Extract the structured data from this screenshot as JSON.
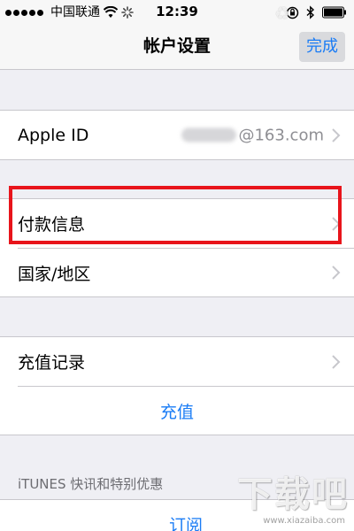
{
  "status_bar": {
    "carrier": "中国联通",
    "time": "12:39"
  },
  "nav": {
    "title": "帐户设置",
    "done_label": "完成"
  },
  "account_group": {
    "apple_id_label": "Apple ID",
    "apple_id_value_suffix": "@163.com"
  },
  "payment_group": {
    "payment_info_label": "付款信息",
    "country_region_label": "国家/地区"
  },
  "recharge_group": {
    "recharge_history_label": "充值记录",
    "recharge_label": "充值"
  },
  "itunes_section": {
    "header": "iTUNES 快讯和特别优惠",
    "subscribe_label": "订阅"
  },
  "watermark": {
    "text": "下载吧",
    "url": "www.xiazaiba.com"
  },
  "colors": {
    "accent": "#1a7cf5",
    "highlight": "#e8141b",
    "background": "#efeff4",
    "separator": "#c8c7cc"
  },
  "icons": [
    "signal-dots-icon",
    "wifi-icon",
    "activity-spinner-icon",
    "rotation-lock-icon",
    "bluetooth-icon",
    "battery-icon",
    "chevron-right-icon"
  ]
}
